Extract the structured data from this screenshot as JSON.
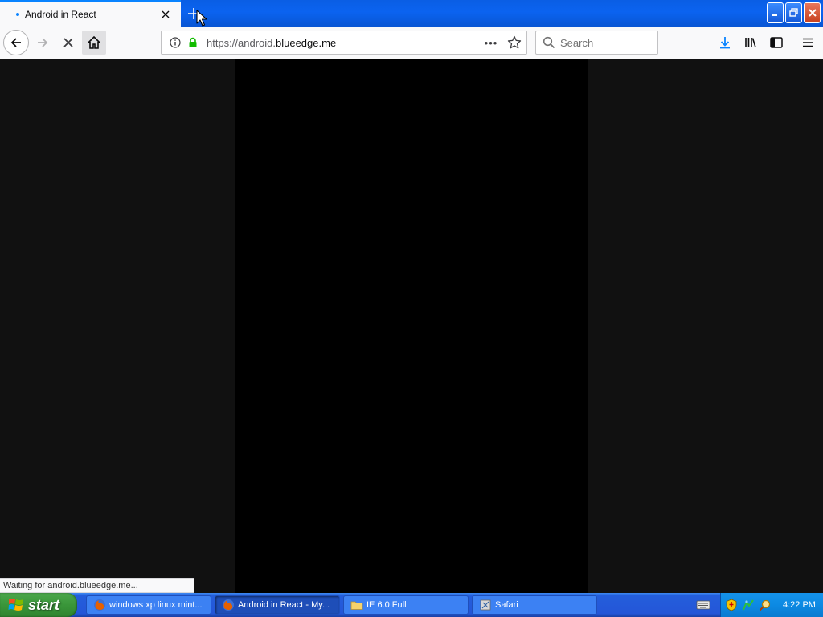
{
  "browser": {
    "tab": {
      "title": "Android in React"
    },
    "url": {
      "prefix": "https://android.",
      "host": "blueedge.me"
    },
    "search": {
      "placeholder": "Search"
    },
    "status": "Waiting for android.blueedge.me..."
  },
  "taskbar": {
    "start_label": "start",
    "tasks": [
      {
        "label": "windows xp linux mint...",
        "icon": "firefox-icon"
      },
      {
        "label": "Android in React - My...",
        "icon": "firefox-icon"
      },
      {
        "label": "IE 6.0 Full",
        "icon": "folder-icon"
      },
      {
        "label": "Safari",
        "icon": "safari-icon"
      }
    ],
    "clock": "4:22 PM"
  },
  "colors": {
    "accent": "#0a84ff",
    "titlebar": "#0b63f0",
    "taskbar": "#245edb",
    "start": "#3a963a",
    "page_bg": "#111111",
    "app_bg": "#000000"
  }
}
